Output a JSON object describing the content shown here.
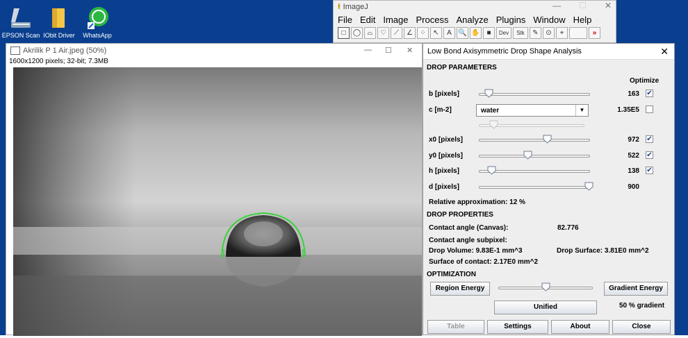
{
  "desktop": {
    "icons": [
      {
        "label": "EPSON Scan",
        "icon": "scanner-icon"
      },
      {
        "label": "IObit Driver",
        "icon": "folder-icon"
      },
      {
        "label": "WhatsApp",
        "icon": "whatsapp-icon"
      }
    ]
  },
  "imagej": {
    "title": "ImageJ",
    "menu": [
      "File",
      "Edit",
      "Image",
      "Process",
      "Analyze",
      "Plugins",
      "Window",
      "Help"
    ],
    "tools": [
      "□",
      "◯",
      "⌓",
      "♡",
      "⟋",
      "∠",
      "⁘",
      "↖",
      "A",
      "🔍",
      "✋",
      "■",
      "Dev",
      "Stk",
      "✎",
      "⊙",
      "⌖",
      "",
      "»"
    ]
  },
  "image_window": {
    "title": "Akrilik P 1 Air.jpeg (50%)",
    "info": "1600x1200 pixels; 32-bit; 7.3MB",
    "controls": {
      "minimize": "—",
      "maximize": "☐",
      "close": "✕"
    }
  },
  "dialog": {
    "title": "Low Bond Axisymmetric Drop Shape Analysis",
    "close": "✕",
    "drop_parameters_header": "DROP PARAMETERS",
    "optimize_header": "Optimize",
    "params": [
      {
        "label": "b [pixels]",
        "value": "163",
        "checked": true,
        "slider": 0.09
      },
      {
        "label": "x0 [pixels]",
        "value": "972",
        "checked": true,
        "slider": 0.61
      },
      {
        "label": "y0 [pixels]",
        "value": "522",
        "checked": true,
        "slider": 0.44
      },
      {
        "label": "h [pixels]",
        "value": "138",
        "checked": true,
        "slider": 0.11
      },
      {
        "label": "d [pixels]",
        "value": "900",
        "checked": false,
        "slider": 0.99
      }
    ],
    "c_param": {
      "label": "c [m-2]",
      "selected": "water",
      "value": "1.35E5",
      "checked": false,
      "slider": 0.14
    },
    "relative_approx": "Relative approximation: 12 %",
    "drop_properties_header": "DROP PROPERTIES",
    "contact_angle_canvas_label": "Contact angle (Canvas):",
    "contact_angle_canvas_value": "82.776",
    "contact_angle_subpixel_label": "Contact angle subpixel:",
    "drop_volume": "Drop Volume: 9.83E-1 mm^3",
    "drop_surface": "Drop Surface: 3.81E0 mm^2",
    "surface_contact": "Surface of contact: 2.17E0 mm^2",
    "optimization_header": "OPTIMIZATION",
    "region_energy": "Region Energy",
    "gradient_energy": "Gradient Energy",
    "unified": "Unified",
    "gradient_pct": "50 % gradient",
    "opt_slider": 0.5,
    "buttons": {
      "table": "Table",
      "settings": "Settings",
      "about": "About",
      "close": "Close"
    }
  },
  "colors": {
    "desktop_bg": "#0a3f8f",
    "drop_outline": "#3bd23b",
    "dialog_bg": "#eeeeee"
  }
}
